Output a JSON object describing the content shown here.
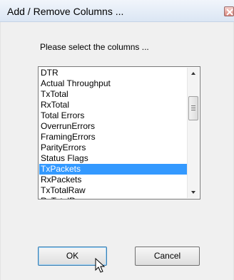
{
  "window": {
    "title": "Add / Remove Columns ..."
  },
  "dialog": {
    "prompt": "Please select the columns ...",
    "columns": [
      {
        "label": "DTR",
        "selected": false
      },
      {
        "label": "Actual Throughput",
        "selected": false
      },
      {
        "label": "TxTotal",
        "selected": false
      },
      {
        "label": "RxTotal",
        "selected": false
      },
      {
        "label": "Total Errors",
        "selected": false
      },
      {
        "label": "OverrunErrors",
        "selected": false
      },
      {
        "label": "FramingErrors",
        "selected": false
      },
      {
        "label": "ParityErrors",
        "selected": false
      },
      {
        "label": "Status Flags",
        "selected": false
      },
      {
        "label": "TxPackets",
        "selected": true
      },
      {
        "label": "RxPackets",
        "selected": false
      },
      {
        "label": "TxTotalRaw",
        "selected": false
      },
      {
        "label": "RxTotalRaw",
        "selected": false
      }
    ],
    "ok_label": "OK",
    "cancel_label": "Cancel"
  },
  "colors": {
    "selection": "#3399ff",
    "dialog_bg": "#f0f0f0"
  }
}
